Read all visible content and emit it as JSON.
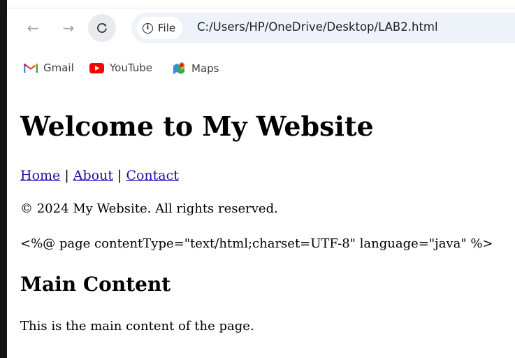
{
  "browser": {
    "site_label": "File",
    "url": "C:/Users/HP/OneDrive/Desktop/LAB2.html",
    "icons": {
      "back": "arrow-left-icon",
      "forward": "arrow-right-icon",
      "reload": "reload-icon",
      "info": "info-icon"
    }
  },
  "bookmarks": [
    {
      "label": "Gmail",
      "icon": "gmail-icon"
    },
    {
      "label": "YouTube",
      "icon": "youtube-icon"
    },
    {
      "label": "Maps",
      "icon": "maps-icon"
    }
  ],
  "page": {
    "heading": "Welcome to My Website",
    "nav": {
      "home": "Home",
      "about": "About",
      "contact": "Contact",
      "separator": " | "
    },
    "copyright": "© 2024 My Website. All rights reserved.",
    "directive": "<%@ page contentType=\"text/html;charset=UTF-8\" language=\"java\" %>",
    "main_heading": "Main Content",
    "main_text": "This is the main content of the page."
  },
  "colors": {
    "link": "#1a0dab",
    "omnibox": "#eef3fa",
    "left_border": "#141414"
  }
}
